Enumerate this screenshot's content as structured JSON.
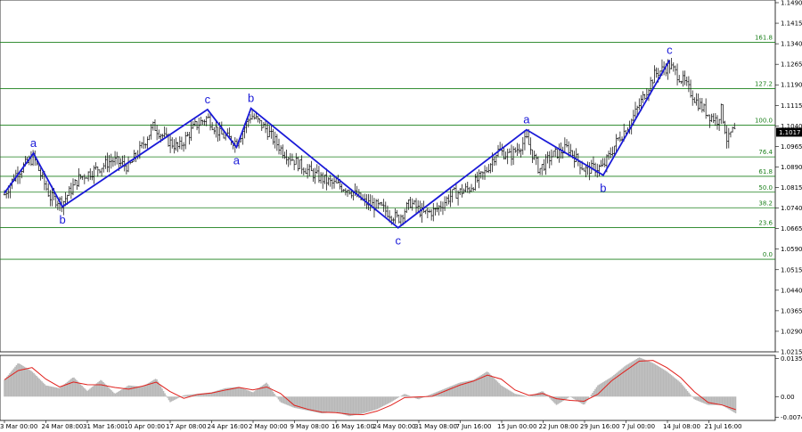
{
  "chart_data": [
    {
      "type": "line",
      "subtype": "candlestick-price-chart",
      "ylim": [
        1.0215,
        1.149
      ],
      "price_ticks": [
        "1.1490",
        "1.1415",
        "1.1340",
        "1.1265",
        "1.1190",
        "1.1115",
        "1.1040",
        "1.0965",
        "1.0890",
        "1.0815",
        "1.0740",
        "1.0665",
        "1.0590",
        "1.0515",
        "1.0440",
        "1.0365",
        "1.0290",
        "1.0215"
      ],
      "current_price": "1.1017",
      "x_labels": [
        "3 Mar 00:00",
        "24 Mar 08:00",
        "31 Mar 16:00",
        "10 Apr 00:00",
        "17 Apr 08:00",
        "24 Apr 16:00",
        "2 May 00:00",
        "9 May 08:00",
        "16 May 16:00",
        "24 May 00:00",
        "31 May 08:00",
        "7 Jun 16:00",
        "15 Jun 00:00",
        "22 Jun 08:00",
        "29 Jun 16:00",
        "7 Jul 00:00",
        "14 Jul 08:00",
        "21 Jul 16:00"
      ],
      "fib_levels": [
        {
          "label": "161.8",
          "price": 1.1345
        },
        {
          "label": "127.2",
          "price": 1.1176
        },
        {
          "label": "100.0",
          "price": 1.1043
        },
        {
          "label": "76.4",
          "price": 1.0927
        },
        {
          "label": "61.8",
          "price": 1.0856
        },
        {
          "label": "50.0",
          "price": 1.0798
        },
        {
          "label": "38.2",
          "price": 1.0741
        },
        {
          "label": "23.6",
          "price": 1.0669
        },
        {
          "label": "0.0",
          "price": 1.0553
        }
      ],
      "wave_path": [
        {
          "x": 0.0,
          "y": 1.0795
        },
        {
          "x": 0.7,
          "y": 1.094,
          "label": "a",
          "pos": "above"
        },
        {
          "x": 1.4,
          "y": 1.0745,
          "label": "b",
          "pos": "below"
        },
        {
          "x": 4.9,
          "y": 1.11,
          "label": "c",
          "pos": "above"
        },
        {
          "x": 5.6,
          "y": 1.0962,
          "label": "a",
          "pos": "below"
        },
        {
          "x": 5.95,
          "y": 1.1104,
          "label": "b",
          "pos": "above"
        },
        {
          "x": 9.5,
          "y": 1.0668,
          "label": "c",
          "pos": "below"
        },
        {
          "x": 12.6,
          "y": 1.1026,
          "label": "a",
          "pos": "above"
        },
        {
          "x": 14.45,
          "y": 1.086,
          "label": "b",
          "pos": "below"
        },
        {
          "x": 16.05,
          "y": 1.128,
          "label": "c",
          "pos": "above"
        }
      ],
      "price_anchors": [
        {
          "x": 0.0,
          "y": 1.079
        },
        {
          "x": 0.3,
          "y": 1.087
        },
        {
          "x": 0.7,
          "y": 1.0925
        },
        {
          "x": 1.1,
          "y": 1.078
        },
        {
          "x": 1.4,
          "y": 1.076
        },
        {
          "x": 1.8,
          "y": 1.085
        },
        {
          "x": 2.2,
          "y": 1.088
        },
        {
          "x": 2.6,
          "y": 1.0915
        },
        {
          "x": 3.0,
          "y": 1.089
        },
        {
          "x": 3.3,
          "y": 1.096
        },
        {
          "x": 3.6,
          "y": 1.104
        },
        {
          "x": 3.9,
          "y": 1.099
        },
        {
          "x": 4.2,
          "y": 1.096
        },
        {
          "x": 4.6,
          "y": 1.104
        },
        {
          "x": 4.9,
          "y": 1.107
        },
        {
          "x": 5.2,
          "y": 1.101
        },
        {
          "x": 5.6,
          "y": 1.098
        },
        {
          "x": 5.95,
          "y": 1.108
        },
        {
          "x": 6.3,
          "y": 1.103
        },
        {
          "x": 6.7,
          "y": 1.095
        },
        {
          "x": 7.1,
          "y": 1.09
        },
        {
          "x": 7.5,
          "y": 1.086
        },
        {
          "x": 7.9,
          "y": 1.083
        },
        {
          "x": 8.3,
          "y": 1.081
        },
        {
          "x": 8.7,
          "y": 1.076
        },
        {
          "x": 9.1,
          "y": 1.074
        },
        {
          "x": 9.5,
          "y": 1.07
        },
        {
          "x": 9.8,
          "y": 1.076
        },
        {
          "x": 10.1,
          "y": 1.072
        },
        {
          "x": 10.4,
          "y": 1.073
        },
        {
          "x": 10.8,
          "y": 1.079
        },
        {
          "x": 11.2,
          "y": 1.081
        },
        {
          "x": 11.6,
          "y": 1.087
        },
        {
          "x": 11.9,
          "y": 1.095
        },
        {
          "x": 12.2,
          "y": 1.093
        },
        {
          "x": 12.6,
          "y": 1.099
        },
        {
          "x": 12.9,
          "y": 1.088
        },
        {
          "x": 13.2,
          "y": 1.093
        },
        {
          "x": 13.6,
          "y": 1.096
        },
        {
          "x": 14.0,
          "y": 1.088
        },
        {
          "x": 14.45,
          "y": 1.089
        },
        {
          "x": 14.8,
          "y": 1.099
        },
        {
          "x": 15.1,
          "y": 1.105
        },
        {
          "x": 15.4,
          "y": 1.114
        },
        {
          "x": 15.7,
          "y": 1.123
        },
        {
          "x": 16.05,
          "y": 1.126
        },
        {
          "x": 16.4,
          "y": 1.12
        },
        {
          "x": 16.7,
          "y": 1.113
        },
        {
          "x": 17.0,
          "y": 1.108
        },
        {
          "x": 17.2,
          "y": 1.106
        },
        {
          "x": 17.3,
          "y": 1.11
        },
        {
          "x": 17.45,
          "y": 1.098
        },
        {
          "x": 17.55,
          "y": 1.102
        }
      ]
    },
    {
      "type": "area",
      "subtype": "oscillator",
      "ylim": [
        -0.0085,
        0.0147
      ],
      "ticks": [
        "0.01354",
        "0.00",
        "-0.00743"
      ],
      "series": [
        {
          "values": [
            0.006,
            0.012,
            0.009,
            0.004,
            0.003,
            0.007,
            0.002,
            0.006,
            0.001,
            0.004,
            0.0035,
            0.0065,
            -0.002,
            0.0005,
            0.001,
            0.0015,
            0.003,
            0.0035,
            0.0015,
            0.005,
            -0.002,
            -0.004,
            -0.005,
            -0.006,
            -0.0055,
            -0.007,
            -0.006,
            -0.0045,
            -0.002,
            0.001,
            -0.001,
            0.001,
            0.003,
            0.005,
            0.006,
            0.009,
            0.004,
            0.001,
            0.0,
            0.002,
            -0.003,
            0.0,
            -0.003,
            0.004,
            0.007,
            0.011,
            0.014,
            0.012,
            0.009,
            0.005,
            -0.001,
            -0.003,
            -0.003,
            -0.006
          ]
        }
      ]
    }
  ]
}
